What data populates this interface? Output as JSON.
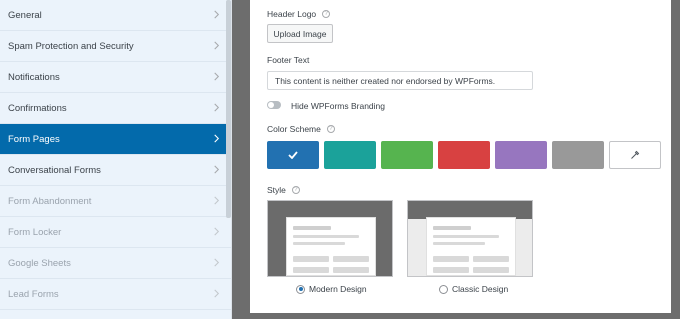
{
  "sidebar": {
    "items": [
      {
        "label": "General",
        "state": "normal"
      },
      {
        "label": "Spam Protection and Security",
        "state": "normal"
      },
      {
        "label": "Notifications",
        "state": "normal"
      },
      {
        "label": "Confirmations",
        "state": "normal"
      },
      {
        "label": "Form Pages",
        "state": "active"
      },
      {
        "label": "Conversational Forms",
        "state": "normal"
      },
      {
        "label": "Form Abandonment",
        "state": "disabled"
      },
      {
        "label": "Form Locker",
        "state": "disabled"
      },
      {
        "label": "Google Sheets",
        "state": "disabled"
      },
      {
        "label": "Lead Forms",
        "state": "disabled"
      }
    ],
    "chevron_icon": "chevron-right-icon"
  },
  "settings": {
    "header_logo_label": "Header Logo",
    "upload_button_label": "Upload Image",
    "footer_text_label": "Footer Text",
    "footer_text_value": "This content is neither created nor endorsed by WPForms.",
    "hide_branding_label": "Hide WPForms Branding",
    "hide_branding_enabled": false,
    "color_scheme_label": "Color Scheme",
    "color_swatches": [
      "#2271b1",
      "#1ba29a",
      "#56b44f",
      "#d84141",
      "#9776bf",
      "#999999"
    ],
    "selected_swatch": 0,
    "custom_color_icon": "eyedropper-icon",
    "style_label": "Style",
    "styles": [
      {
        "label": "Modern Design",
        "selected": true
      },
      {
        "label": "Classic Design",
        "selected": false
      }
    ],
    "help_icon": "question-circle-icon"
  }
}
